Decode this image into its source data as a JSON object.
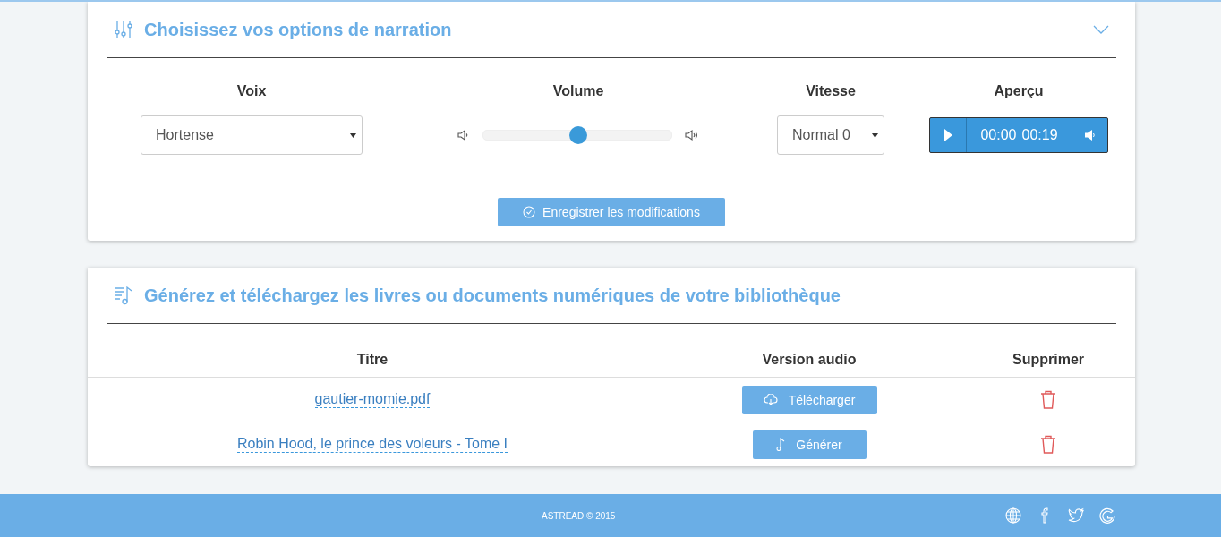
{
  "narration": {
    "title": "Choisissez vos options de narration",
    "fields": [
      {
        "kind": "select",
        "label": "Voix",
        "value": "Hortense"
      },
      {
        "kind": "slider",
        "label": "Volume",
        "level": 0.5
      },
      {
        "kind": "select",
        "label": "Vitesse",
        "value": "Normal 0"
      },
      {
        "kind": "player",
        "label": "Aperçu",
        "current_time": "00:00",
        "duration": "00:19"
      }
    ],
    "save_button": "Enregistrer les modifications"
  },
  "library": {
    "title": "Générez et téléchargez les livres ou documents numériques de votre bibliothèque",
    "columns": [
      "Titre",
      "Version audio",
      "Supprimer"
    ],
    "rows": [
      {
        "title": "gautier-momie.pdf",
        "action": {
          "kind": "download",
          "label": "Télécharger"
        }
      },
      {
        "title": "Robin Hood, le prince des voleurs - Tome I",
        "action": {
          "kind": "generate",
          "label": "Générer"
        }
      }
    ]
  },
  "footer": {
    "copyright": "ASTREAD © 2015"
  }
}
